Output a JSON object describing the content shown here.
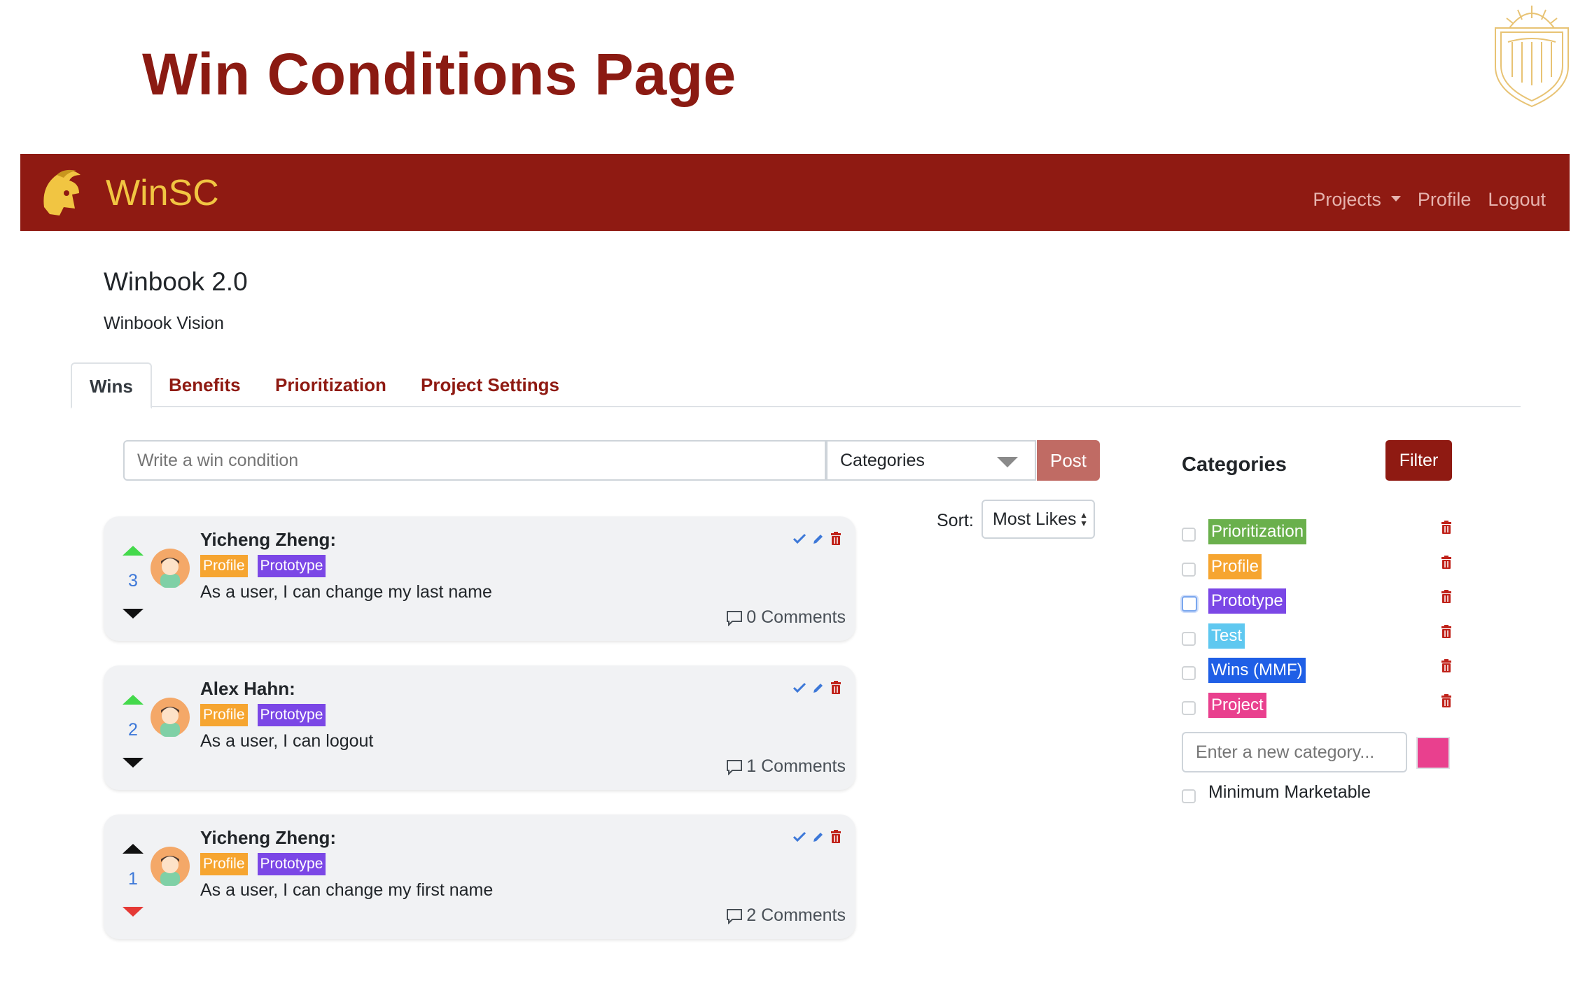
{
  "slide": {
    "title": "Win Conditions Page"
  },
  "navbar": {
    "brand": "WinSC",
    "links": {
      "projects": "Projects",
      "profile": "Profile",
      "logout": "Logout"
    }
  },
  "project": {
    "title": "Winbook 2.0",
    "vision": "Winbook Vision"
  },
  "tabs": [
    "Wins",
    "Benefits",
    "Prioritization",
    "Project Settings"
  ],
  "composer": {
    "placeholder": "Write a win condition",
    "category_select": "Categories",
    "post_label": "Post"
  },
  "sort": {
    "label": "Sort:",
    "value": "Most Likes"
  },
  "wins": [
    {
      "author": "Yicheng Zheng:",
      "votes": "3",
      "tags": [
        "Profile",
        "Prototype"
      ],
      "text": "As a user, I can change my last name",
      "comments": "0 Comments",
      "vote_state": "up"
    },
    {
      "author": "Alex Hahn:",
      "votes": "2",
      "tags": [
        "Profile",
        "Prototype"
      ],
      "text": "As a user, I can logout",
      "comments": "1 Comments",
      "vote_state": "up"
    },
    {
      "author": "Yicheng Zheng:",
      "votes": "1",
      "tags": [
        "Profile",
        "Prototype"
      ],
      "text": "As a user, I can change my first name",
      "comments": "2 Comments",
      "vote_state": "down"
    }
  ],
  "categories_panel": {
    "heading": "Categories",
    "filter_label": "Filter",
    "items": [
      {
        "label": "Prioritization",
        "color": "#6ab04c"
      },
      {
        "label": "Profile",
        "color": "#f6a530"
      },
      {
        "label": "Prototype",
        "color": "#7b47e6"
      },
      {
        "label": "Test",
        "color": "#5fc8f0"
      },
      {
        "label": "Wins (MMF)",
        "color": "#1f5fe6"
      },
      {
        "label": "Project",
        "color": "#e9408e"
      }
    ],
    "new_placeholder": "Enter a new category...",
    "new_color": "#e9408e",
    "mm_label": "Minimum Marketable"
  },
  "colors": {
    "brand": "#8f1a12",
    "gold": "#f1c542"
  }
}
